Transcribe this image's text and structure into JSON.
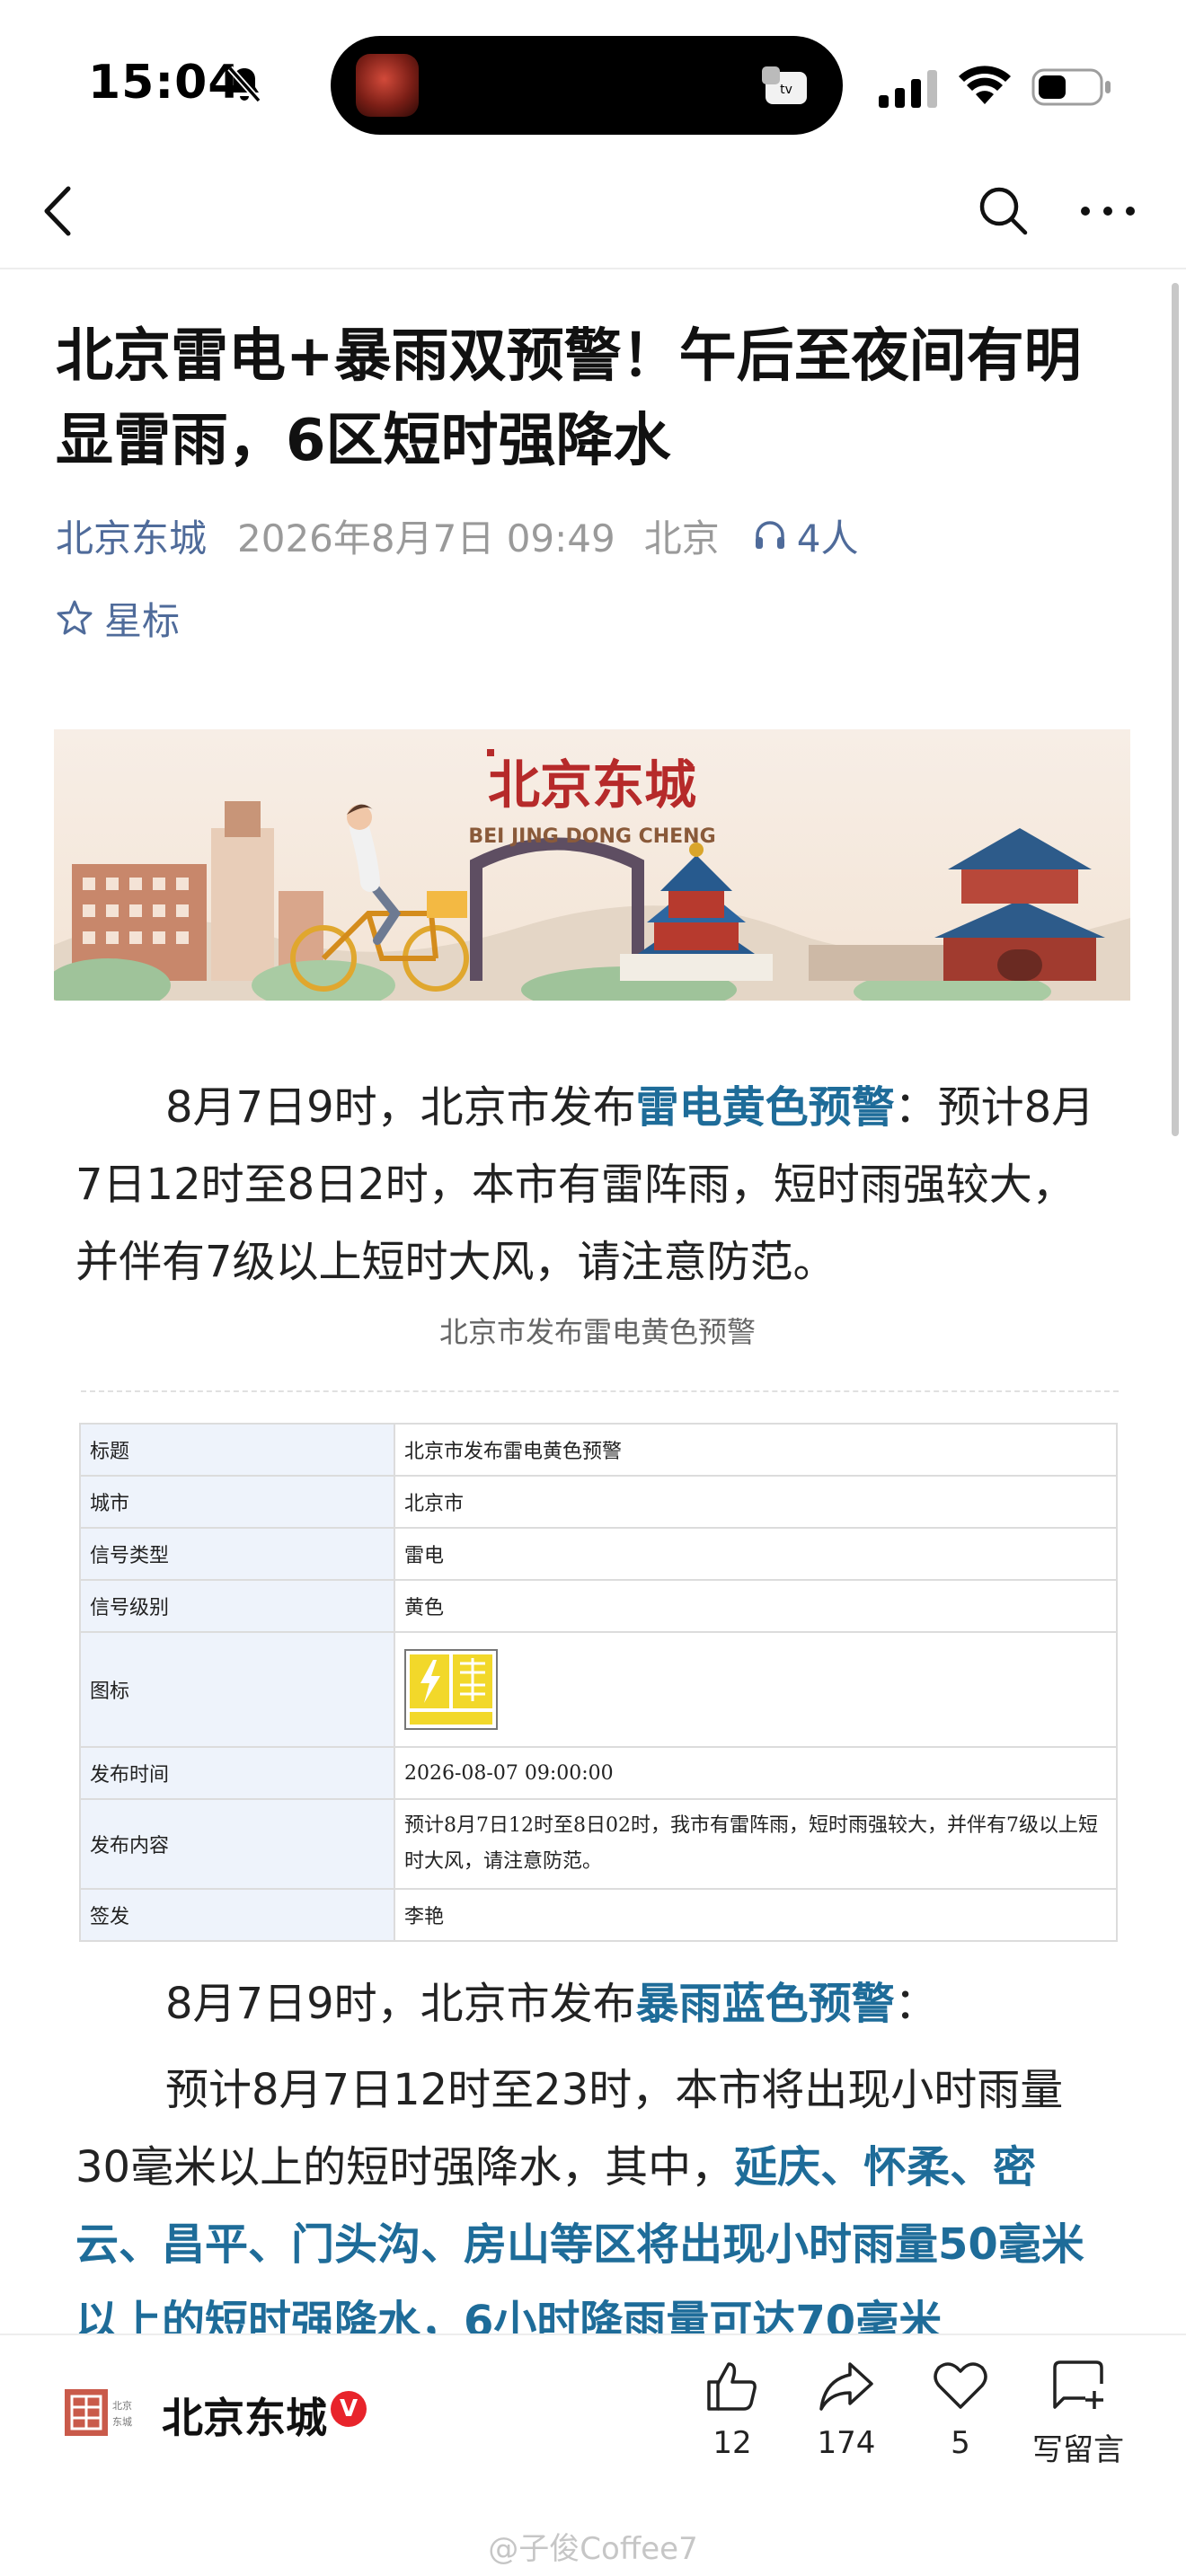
{
  "status_bar": {
    "time": "15:04",
    "island_app": "tv"
  },
  "nav": {
    "back_icon": "chevron-left-icon",
    "search_icon": "search-icon",
    "more_icon": "more-icon"
  },
  "article": {
    "title": "北京雷电+暴雨双预警！午后至夜间有明显雷雨，6区短时强降水",
    "account": "北京东城",
    "date": "2026年8月7日 09:49",
    "location": "北京",
    "listeners": "4人",
    "star_label": "星标",
    "banner_title": "北京东城",
    "banner_subtitle": "BEI JING DONG CHENG",
    "para1_prefix": "8月7日9时，北京市发布",
    "para1_link": "雷电黄色预警",
    "para1_suffix": "：预计8月7日12时至8日2时，本市有雷阵雨，短时雨强较大，并伴有7级以上短时大风，请注意防范。",
    "caption": "北京市发布雷电黄色预警",
    "warning_table": [
      {
        "key": "标题",
        "value": "北京市发布雷电黄色预警"
      },
      {
        "key": "城市",
        "value": "北京市"
      },
      {
        "key": "信号类型",
        "value": "雷电"
      },
      {
        "key": "信号级别",
        "value": "黄色"
      },
      {
        "key": "图标",
        "value": ""
      },
      {
        "key": "发布时间",
        "value": "2026-08-07 09:00:00"
      },
      {
        "key": "发布内容",
        "value": "预计8月7日12时至8日02时，我市有雷阵雨，短时雨强较大，并伴有7级以上短时大风，请注意防范。"
      },
      {
        "key": "签发",
        "value": "李艳"
      }
    ],
    "para2_prefix": "8月7日9时，北京市发布",
    "para2_link": "暴雨蓝色预警",
    "para2_suffix": "：",
    "para3_prefix": "预计8月7日12时至23时，本市将出现小时雨量30毫米以上的短时强降水，其中，",
    "para3_link": "延庆、怀柔、密云、昌平、门头沟、房山等区将出现小时雨量50毫米以上的短时强降水，6小时降雨量可达70毫米"
  },
  "bottom_bar": {
    "account_name": "北京东城",
    "verified_badge": "V",
    "like_count": "12",
    "share_count": "174",
    "favorite_count": "5",
    "comment_label": "写留言"
  },
  "watermark": "@子俊Coffee7",
  "colors": {
    "link": "#1e6c99",
    "meta_blue": "#4f6b9a",
    "verified_red": "#e8242b",
    "table_key_bg": "#eef3fb"
  }
}
